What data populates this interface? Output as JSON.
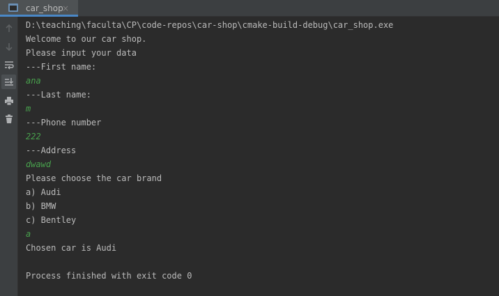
{
  "tab": {
    "title": "car_shop",
    "close_glyph": "×"
  },
  "toolbar": {
    "icons": [
      "arrow-up-icon",
      "arrow-down-icon",
      "soft-wrap-icon",
      "scroll-to-end-icon",
      "print-icon",
      "trash-icon"
    ]
  },
  "console": {
    "lines": [
      {
        "text": "D:\\teaching\\faculta\\CP\\code-repos\\car-shop\\cmake-build-debug\\car_shop.exe",
        "kind": "output"
      },
      {
        "text": "Welcome to our car shop.",
        "kind": "output"
      },
      {
        "text": "Please input your data",
        "kind": "output"
      },
      {
        "text": "---First name:",
        "kind": "output"
      },
      {
        "text": "ana",
        "kind": "input"
      },
      {
        "text": "---Last name:",
        "kind": "output"
      },
      {
        "text": "m",
        "kind": "input"
      },
      {
        "text": "---Phone number",
        "kind": "output"
      },
      {
        "text": "222",
        "kind": "input"
      },
      {
        "text": "---Address",
        "kind": "output"
      },
      {
        "text": "dwawd",
        "kind": "input"
      },
      {
        "text": "Please choose the car brand",
        "kind": "output"
      },
      {
        "text": "a) Audi",
        "kind": "output"
      },
      {
        "text": "b) BMW",
        "kind": "output"
      },
      {
        "text": "c) Bentley",
        "kind": "output"
      },
      {
        "text": "a",
        "kind": "input"
      },
      {
        "text": "Chosen car is Audi",
        "kind": "output"
      },
      {
        "text": "",
        "kind": "output"
      },
      {
        "text": "Process finished with exit code 0",
        "kind": "output"
      }
    ]
  },
  "colors": {
    "background": "#2b2b2b",
    "output_text": "#bbbbbb",
    "input_text": "#48a14d",
    "tab_underline": "#4a88c7"
  }
}
